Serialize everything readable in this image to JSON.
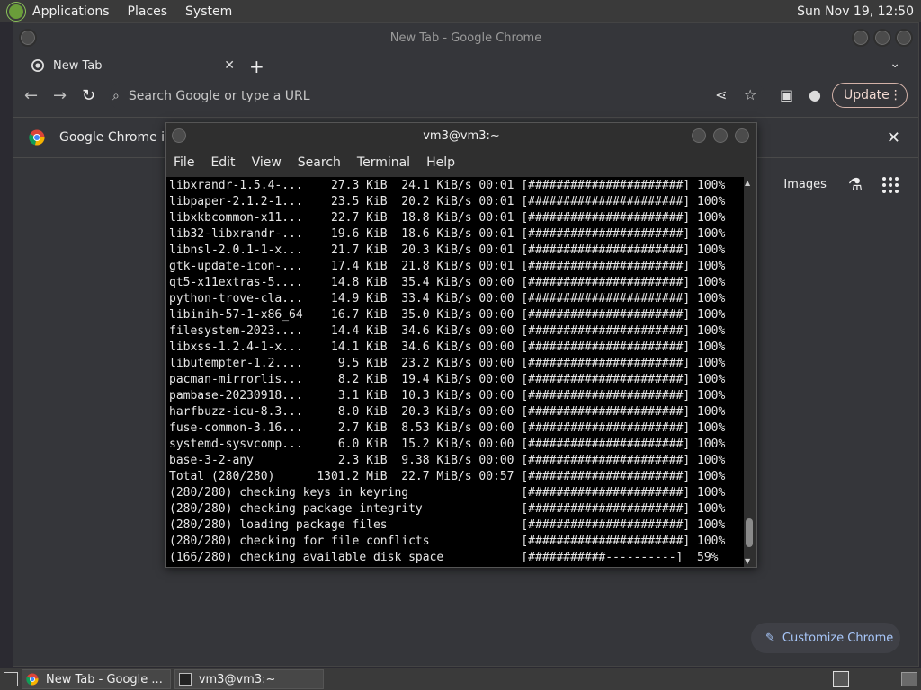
{
  "top_panel": {
    "menu": [
      "Applications",
      "Places",
      "System"
    ],
    "clock": "Sun Nov 19, 12:50"
  },
  "chrome": {
    "window_title": "New Tab - Google Chrome",
    "tab_title": "New Tab",
    "omnibox_placeholder": "Search Google or type a URL",
    "update_label": "Update",
    "infobar_text": "Google Chrome isn",
    "images_link": "Images",
    "customize_label": "Customize Chrome",
    "colors": {
      "accent": "#a8c7fa",
      "update_border": "#d3b2a8"
    }
  },
  "terminal": {
    "title": "vm3@vm3:~",
    "menu": [
      "File",
      "Edit",
      "View",
      "Search",
      "Terminal",
      "Help"
    ],
    "lines": [
      "libxrandr-1.5.4-...    27.3 KiB  24.1 KiB/s 00:01 [######################] 100%",
      "libpaper-2.1.2-1...    23.5 KiB  20.2 KiB/s 00:01 [######################] 100%",
      "libxkbcommon-x11...    22.7 KiB  18.8 KiB/s 00:01 [######################] 100%",
      "lib32-libxrandr-...    19.6 KiB  18.6 KiB/s 00:01 [######################] 100%",
      "libnsl-2.0.1-1-x...    21.7 KiB  20.3 KiB/s 00:01 [######################] 100%",
      "gtk-update-icon-...    17.4 KiB  21.8 KiB/s 00:01 [######################] 100%",
      "qt5-x11extras-5....    14.8 KiB  35.4 KiB/s 00:00 [######################] 100%",
      "python-trove-cla...    14.9 KiB  33.4 KiB/s 00:00 [######################] 100%",
      "libinih-57-1-x86_64    16.7 KiB  35.0 KiB/s 00:00 [######################] 100%",
      "filesystem-2023....    14.4 KiB  34.6 KiB/s 00:00 [######################] 100%",
      "libxss-1.2.4-1-x...    14.1 KiB  34.6 KiB/s 00:00 [######################] 100%",
      "libutempter-1.2....     9.5 KiB  23.2 KiB/s 00:00 [######################] 100%",
      "pacman-mirrorlis...     8.2 KiB  19.4 KiB/s 00:00 [######################] 100%",
      "pambase-20230918...     3.1 KiB  10.3 KiB/s 00:00 [######################] 100%",
      "harfbuzz-icu-8.3...     8.0 KiB  20.3 KiB/s 00:00 [######################] 100%",
      "fuse-common-3.16...     2.7 KiB  8.53 KiB/s 00:00 [######################] 100%",
      "systemd-sysvcomp...     6.0 KiB  15.2 KiB/s 00:00 [######################] 100%",
      "base-3-2-any            2.3 KiB  9.38 KiB/s 00:00 [######################] 100%",
      "Total (280/280)      1301.2 MiB  22.7 MiB/s 00:57 [######################] 100%",
      "(280/280) checking keys in keyring                [######################] 100%",
      "(280/280) checking package integrity              [######################] 100%",
      "(280/280) loading package files                   [######################] 100%",
      "(280/280) checking for file conflicts             [######################] 100%",
      "(166/280) checking available disk space           [###########----------]  59%"
    ]
  },
  "taskbar": {
    "chrome_task": "New Tab - Google ...",
    "terminal_task": "vm3@vm3:~"
  }
}
